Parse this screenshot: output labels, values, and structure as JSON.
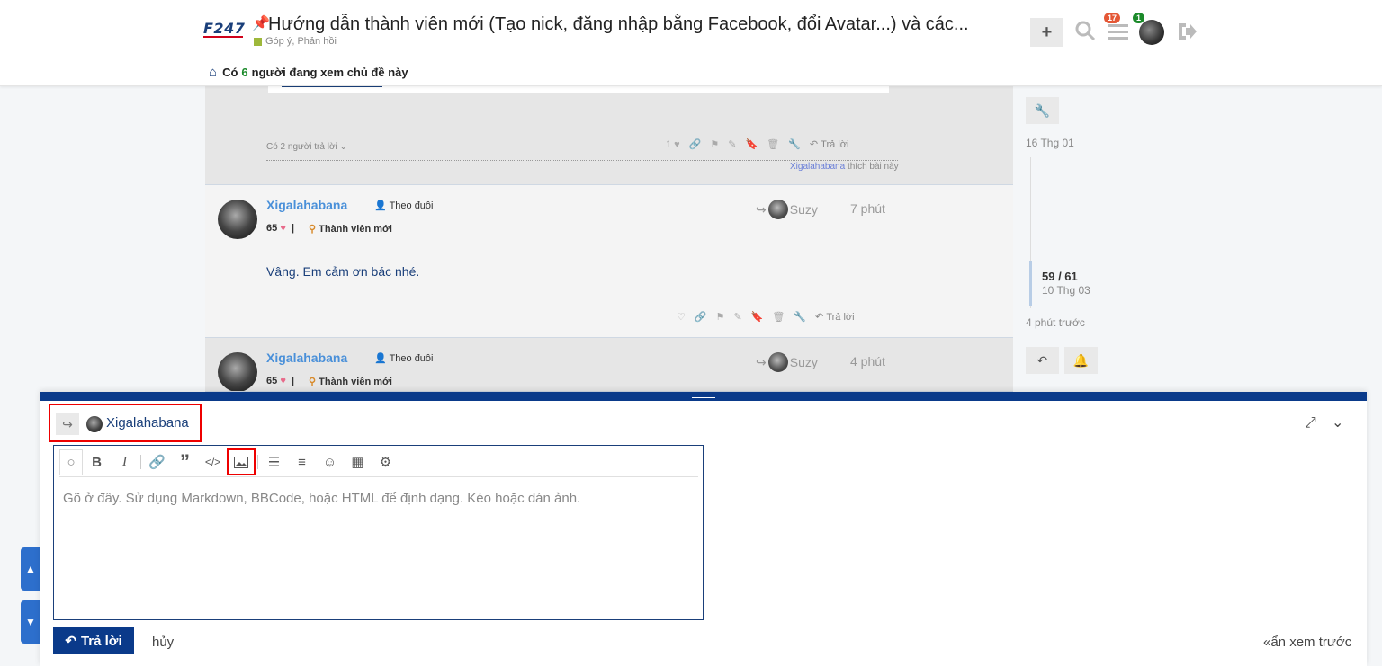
{
  "header": {
    "logo_main": "F247",
    "title": "Hướng dẫn thành viên mới (Tạo nick, đăng nhập bằng Facebook, đổi Avatar...) và các...",
    "category": "Góp ý, Phản hồi",
    "viewers_prefix": "Có",
    "viewers_count": "6",
    "viewers_suffix": "người đang xem chủ đề này",
    "plus": "+",
    "notif_count": "17",
    "msg_count": "1"
  },
  "prev_post": {
    "replies_toggle": "Có 2 người trả lời",
    "like_count": "1",
    "reply_label": "Trả lời",
    "liked_by_user": "Xigalahabana",
    "liked_by_suffix": "thích bài này"
  },
  "posts": [
    {
      "username": "Xigalahabana",
      "follow": "Theo đuôi",
      "likes": "65",
      "rank": "Thành viên mới",
      "reply_to": "Suzy",
      "time": "7 phút",
      "body": "Vâng. Em cảm ơn bác nhé.",
      "reply_label": "Trả lời"
    },
    {
      "username": "Xigalahabana",
      "follow": "Theo đuôi",
      "likes": "65",
      "rank": "Thành viên mới",
      "reply_to": "Suzy",
      "time": "4 phút"
    }
  ],
  "timeline": {
    "start_date": "16 Thg 01",
    "position": "59 / 61",
    "position_date": "10 Thg 03",
    "ago": "4 phút trước"
  },
  "composer": {
    "reply_to_user": "Xigalahabana",
    "placeholder": "Gõ ở đây. Sử dụng Markdown, BBCode, hoặc HTML để định dạng. Kéo hoặc dán ảnh.",
    "submit_label": "Trả lời",
    "cancel_label": "hủy",
    "hide_preview_label": "«ẩn xem trước"
  },
  "colors": {
    "brand": "#0a3a8a",
    "link": "#4a90d9",
    "highlight": "#e00000"
  }
}
